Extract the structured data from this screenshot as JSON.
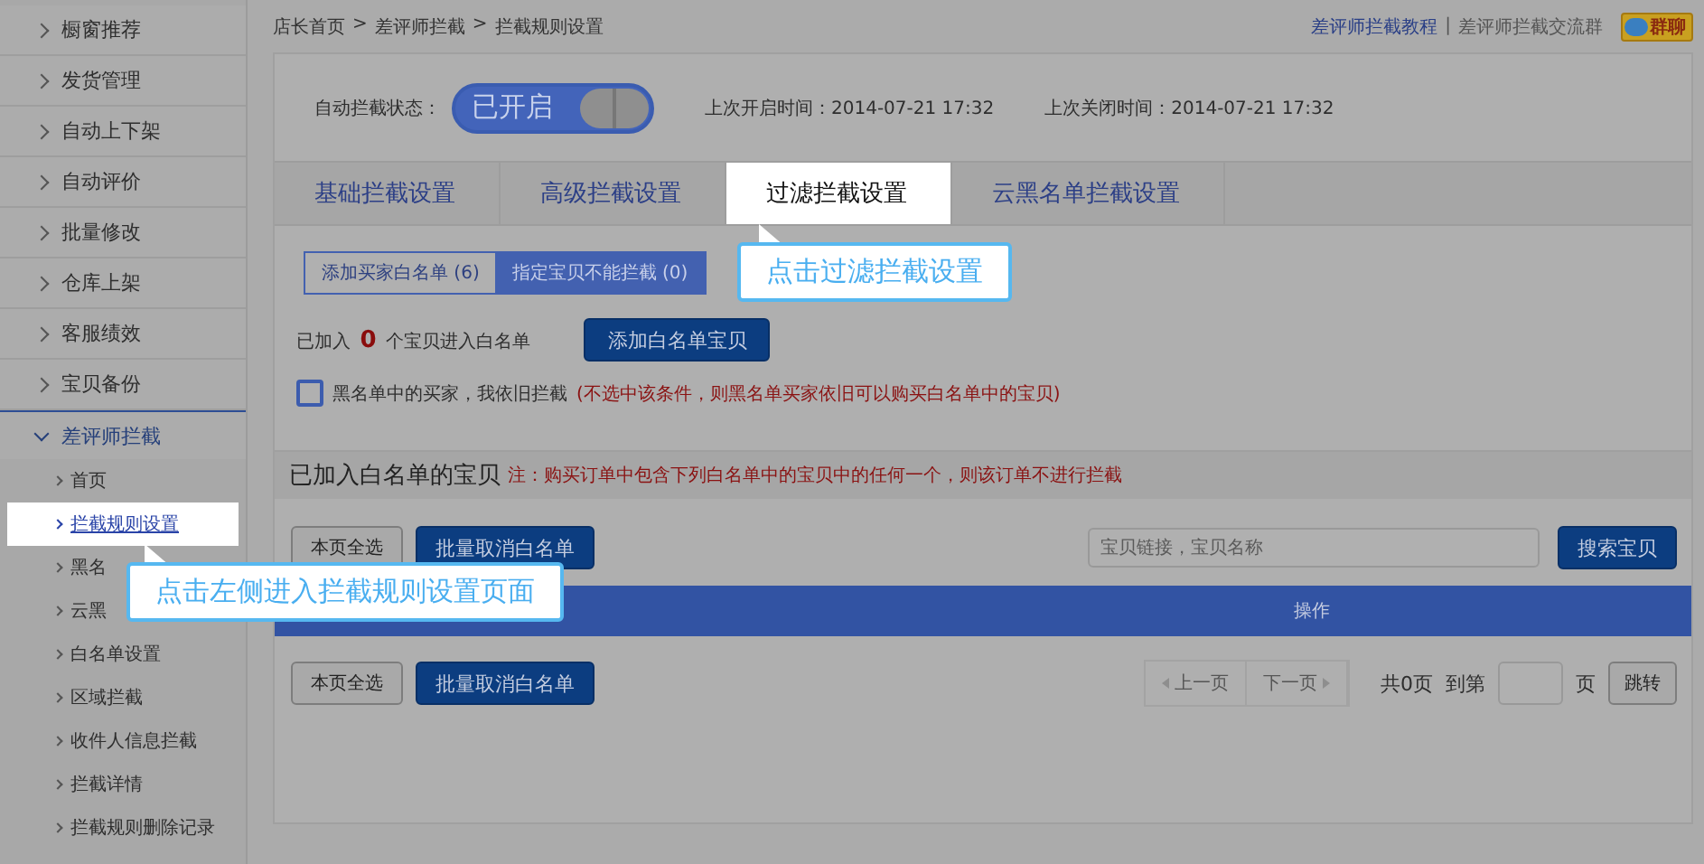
{
  "sidebar": {
    "items": [
      {
        "label": "橱窗推荐",
        "expanded": false
      },
      {
        "label": "发货管理",
        "expanded": false
      },
      {
        "label": "自动上下架",
        "expanded": false
      },
      {
        "label": "自动评价",
        "expanded": false
      },
      {
        "label": "批量修改",
        "expanded": false
      },
      {
        "label": "仓库上架",
        "expanded": false
      },
      {
        "label": "客服绩效",
        "expanded": false
      },
      {
        "label": "宝贝备份",
        "expanded": false
      },
      {
        "label": "差评师拦截",
        "expanded": true,
        "children": [
          {
            "label": "首页",
            "selected": false
          },
          {
            "label": "拦截规则设置",
            "selected": true
          },
          {
            "label": "黑名",
            "selected": false
          },
          {
            "label": "云黑",
            "selected": false
          },
          {
            "label": "白名单设置",
            "selected": false
          },
          {
            "label": "区域拦截",
            "selected": false
          },
          {
            "label": "收件人信息拦截",
            "selected": false
          },
          {
            "label": "拦截详情",
            "selected": false
          },
          {
            "label": "拦截规则删除记录",
            "selected": false
          }
        ]
      }
    ]
  },
  "breadcrumb": {
    "items": [
      "店长首页",
      "差评师拦截",
      "拦截规则设置"
    ],
    "separator": ">"
  },
  "help_links": {
    "items": [
      "差评师拦截教程",
      "差评师拦截交流群"
    ],
    "separator": "|",
    "badge": "群聊"
  },
  "auto_intercept": {
    "label": "自动拦截状态：",
    "toggle_text": "已开启",
    "on": true,
    "last_on": "上次开启时间：2014-07-21 17:32",
    "last_off": "上次关闭时间：2014-07-21 17:32"
  },
  "tabs": [
    {
      "label": "基础拦截设置",
      "selected": false
    },
    {
      "label": "高级拦截设置",
      "selected": false
    },
    {
      "label": "过滤拦截设置",
      "selected": true
    },
    {
      "label": "云黑名单拦截设置",
      "selected": false
    }
  ],
  "sub_tabs": [
    {
      "label": "添加买家白名单 (6)",
      "selected": false
    },
    {
      "label": "指定宝贝不能拦截 (0)",
      "selected": true
    }
  ],
  "whitelist_count": {
    "prefix": "已加入",
    "count": "0",
    "suffix": "个宝贝进入白名单"
  },
  "add_button": "添加白名单宝贝",
  "blacklist_option": {
    "label": "黑名单中的买家，我依旧拦截",
    "note": "(不选中该条件，则黑名单买家依旧可以购买白名单中的宝贝)",
    "checked": false
  },
  "section": {
    "title": "已加入白名单的宝贝",
    "note": "注：购买订单中包含下列白名单中的宝贝中的任何一个，则该订单不进行拦截"
  },
  "toolbar": {
    "select_all": "本页全选",
    "bulk_cancel": "批量取消白名单",
    "search_placeholder": "宝贝链接，宝贝名称",
    "search_button": "搜索宝贝"
  },
  "table": {
    "columns": [
      "操作"
    ]
  },
  "footer": {
    "select_all": "本页全选",
    "bulk_cancel": "批量取消白名单",
    "prev": "上一页",
    "next": "下一页",
    "pager_disabled": true,
    "total": "共0页",
    "goto": "到第",
    "unit": "页",
    "jump": "跳转"
  },
  "callouts": [
    {
      "text": "点击过滤拦截设置"
    },
    {
      "text": "点击左侧进入拦截规则设置页面"
    }
  ]
}
